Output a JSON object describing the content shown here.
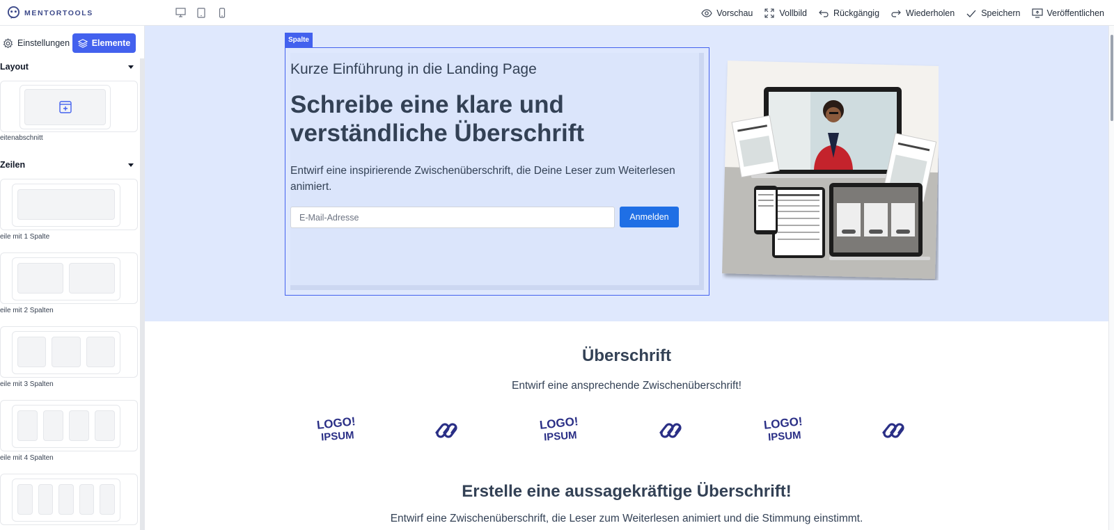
{
  "app": {
    "logo_text": "MENTORTOOLS"
  },
  "toolbar": {
    "devices": [
      "desktop-icon",
      "tablet-icon",
      "mobile-icon"
    ],
    "preview": "Vorschau",
    "fullscreen": "Vollbild",
    "undo": "Rückgängig",
    "redo": "Wiederholen",
    "save": "Speichern",
    "publish": "Veröffentlichen"
  },
  "sidebar": {
    "tab_settings": "Einstellungen",
    "tab_elements": "Elemente",
    "section_layout": "Layout",
    "layout_card_label": "eitenabschnitt",
    "section_rows": "Zeilen",
    "rows": [
      {
        "label": "eile mit 1 Spalte",
        "cols": 1
      },
      {
        "label": "eile mit 2 Spalten",
        "cols": 2
      },
      {
        "label": "eile mit 3 Spalten",
        "cols": 3
      },
      {
        "label": "eile mit 4 Spalten",
        "cols": 4
      },
      {
        "label": "",
        "cols": 5
      }
    ]
  },
  "canvas": {
    "column_tag": "Spalte",
    "hero": {
      "eyebrow": "Kurze Einführung in die Landing Page",
      "headline": "Schreibe eine klare und verständliche Überschrift",
      "subheadline": "Entwirf eine inspirierende Zwischenüberschrift, die Deine Leser zum Weiterlesen animiert.",
      "email_placeholder": "E-Mail-Adresse",
      "submit_label": "Anmelden"
    },
    "logos_section": {
      "title": "Überschrift",
      "subtitle": "Entwirf eine ansprechende Zwischenüberschrift!",
      "logos": [
        "LOGO",
        "IPSUM",
        "LOGO",
        "IPSUM",
        "LOGO",
        "IPSUM"
      ]
    },
    "section3": {
      "title": "Erstelle eine aussagekräftige Überschrift!",
      "subtitle": "Entwirf eine Zwischenüberschrift, die Leser zum Weiterlesen animiert und die Stimmung einstimmt."
    }
  },
  "colors": {
    "accent": "#4361ee",
    "hero_bg": "#dfe8fd",
    "button": "#1f6fe5",
    "text_dark": "#334155",
    "logo_navy": "#2a2f86"
  }
}
